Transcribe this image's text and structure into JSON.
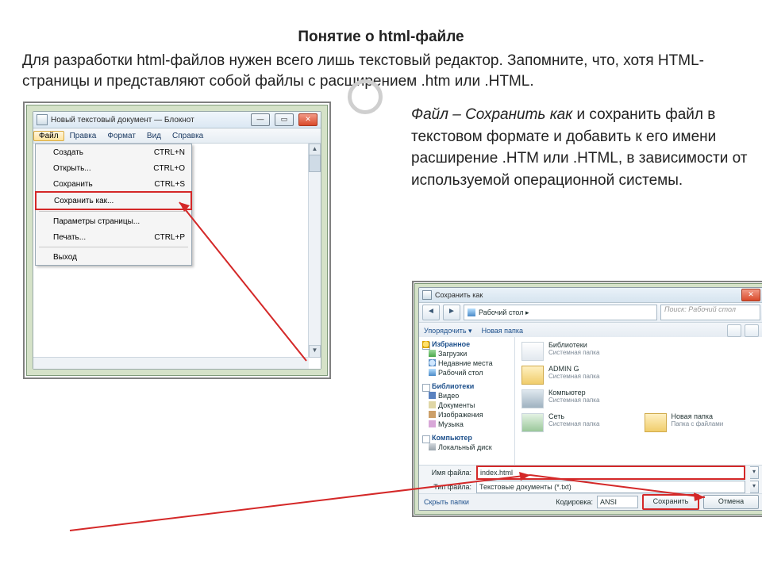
{
  "title": "Понятие о html-файле",
  "intro": "Для разработки html-файлов нужен всего лишь текстовый редактор. Запомните, что, хотя HTML-страницы и представляют собой файлы с расширением .htm или .HTML.",
  "right_block": {
    "lead_italic": "Файл – Сохранить как",
    "rest": " и сохранить файл в текстовом формате и добавить к его имени расширение .HTM или .HTML, в зависимости от используемой операционной системы."
  },
  "notepad": {
    "title": "Новый текстовый документ — Блокнот",
    "menu": [
      "Файл",
      "Правка",
      "Формат",
      "Вид",
      "Справка"
    ],
    "dropdown": [
      {
        "label": "Создать",
        "accel": "CTRL+N"
      },
      {
        "label": "Открыть...",
        "accel": "CTRL+O"
      },
      {
        "label": "Сохранить",
        "accel": "CTRL+S"
      },
      {
        "label": "Сохранить как...",
        "accel": "",
        "hl": true
      },
      {
        "sep": true
      },
      {
        "label": "Параметры страницы...",
        "accel": ""
      },
      {
        "label": "Печать...",
        "accel": "CTRL+P"
      },
      {
        "sep": true
      },
      {
        "label": "Выход",
        "accel": ""
      }
    ]
  },
  "saveas": {
    "title": "Сохранить как",
    "breadcrumb": "Рабочий стол  ▸",
    "search_placeholder": "Поиск: Рабочий стол",
    "toolbar": {
      "organize": "Упорядочить ▾",
      "newfolder": "Новая папка"
    },
    "tree": {
      "fav": {
        "head": "Избранное",
        "items": [
          {
            "ic": "dl",
            "label": "Загрузки"
          },
          {
            "ic": "clock",
            "label": "Недавние места"
          },
          {
            "ic": "desk",
            "label": "Рабочий стол"
          }
        ]
      },
      "lib": {
        "head": "Библиотеки",
        "items": [
          {
            "ic": "vid",
            "label": "Видео"
          },
          {
            "ic": "doc",
            "label": "Документы"
          },
          {
            "ic": "img",
            "label": "Изображения"
          },
          {
            "ic": "mus",
            "label": "Музыка"
          }
        ]
      },
      "pc": {
        "head": "Компьютер",
        "items": [
          {
            "ic": "hdd",
            "label": "Локальный диск"
          }
        ]
      }
    },
    "content": [
      {
        "ic": "lib",
        "name": "Библиотеки",
        "sub": "Системная папка"
      },
      {
        "ic": "fold",
        "name": "ADMIN G",
        "sub": "Системная папка"
      },
      {
        "ic": "pc",
        "name": "Компьютер",
        "sub": "Системная папка"
      },
      {
        "ic": "net",
        "name": "Сеть",
        "sub": "Системная папка"
      },
      {
        "ic": "fold",
        "name": "Новая папка",
        "sub": "Папка с файлами"
      }
    ],
    "filename_label": "Имя файла:",
    "filename_value": "index.html",
    "filetype_label": "Тип файла:",
    "filetype_value": "Текстовые документы (*.txt)",
    "hide": "Скрыть папки",
    "encoding_label": "Кодировка:",
    "encoding_value": "ANSI",
    "save_btn": "Сохранить",
    "cancel_btn": "Отмена"
  }
}
